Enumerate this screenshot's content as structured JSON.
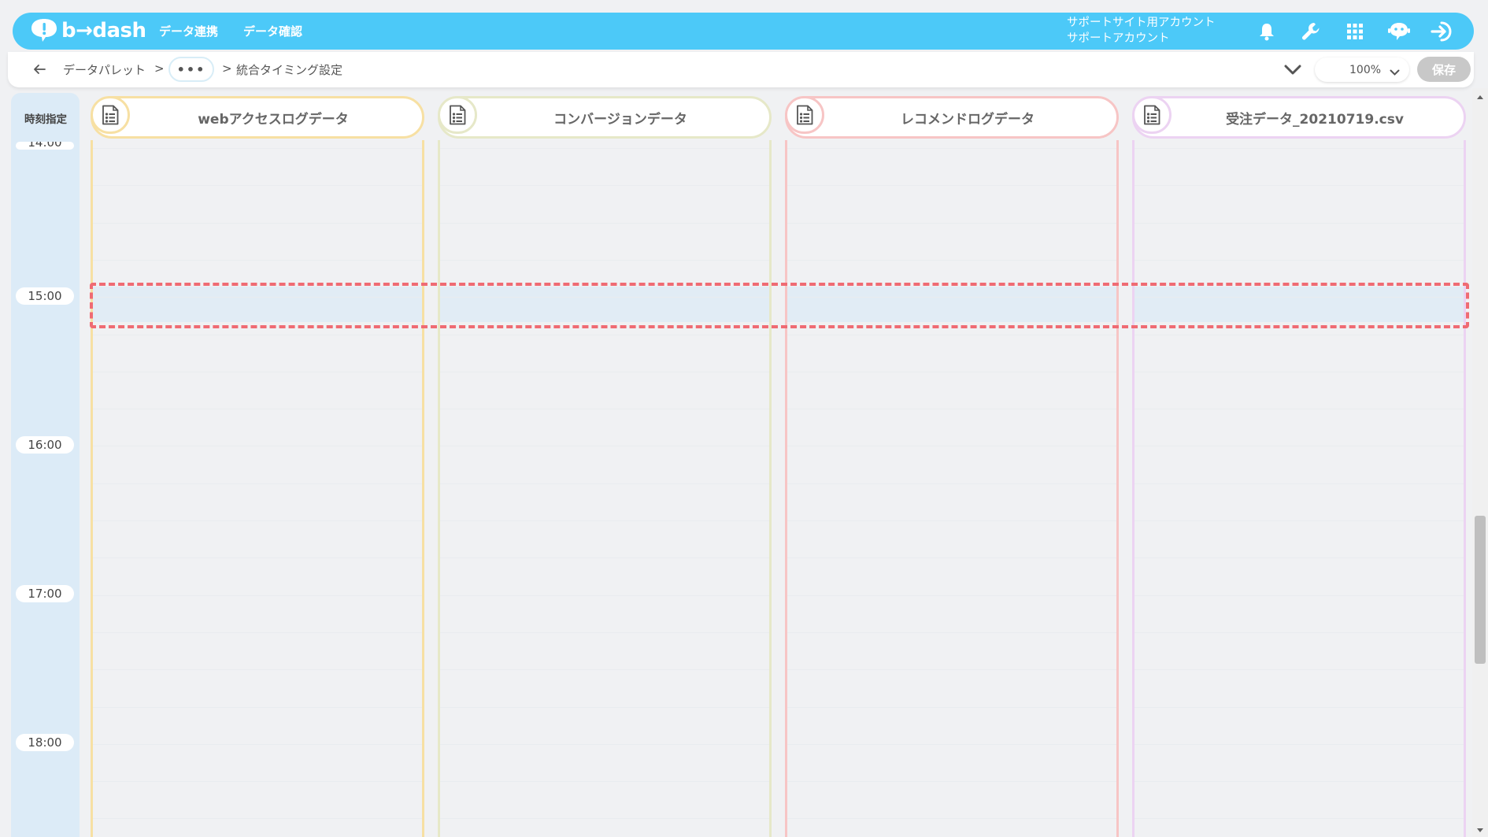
{
  "app": {
    "logo_text": "b→dash"
  },
  "nav": [
    {
      "label": "データ連携"
    },
    {
      "label": "データ確認"
    }
  ],
  "account": {
    "line1": "サポートサイト用アカウント",
    "line2": "サポートアカウント"
  },
  "header_icons": [
    "bell-icon",
    "wrench-icon",
    "grid-apps-icon",
    "chat-bot-icon",
    "logout-icon"
  ],
  "breadcrumb": {
    "first": "データパレット",
    "separator": ">",
    "ellipsis": "•••",
    "current": "統合タイミング設定"
  },
  "toolbar": {
    "zoom": "100%",
    "save_label": "保存"
  },
  "timeline": {
    "header_label": "時刻指定",
    "partial_label": "14:00",
    "times": [
      "15:00",
      "16:00",
      "17:00",
      "18:00"
    ],
    "selected_slot": "15:00"
  },
  "sources": [
    {
      "name": "webアクセスログデータ",
      "color": "#f7e0a3"
    },
    {
      "name": "コンバージョンデータ",
      "color": "#e6e8c8"
    },
    {
      "name": "レコメンドログデータ",
      "color": "#f7c5c5"
    },
    {
      "name": "受注データ_20210719.csv",
      "color": "#ecd3f2"
    }
  ],
  "colors": {
    "accent": "#4cc9f8",
    "selection": "#ef6b73",
    "highlight": "#e1ecf5"
  }
}
